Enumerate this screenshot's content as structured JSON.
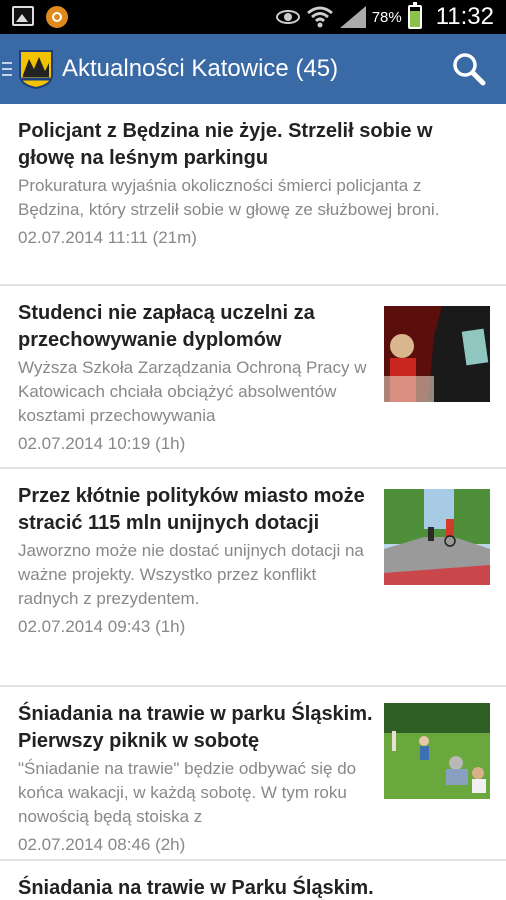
{
  "status_bar": {
    "battery": "78%",
    "time": "11:32",
    "icons": [
      "image-icon",
      "sync-app-icon",
      "eye-icon",
      "wifi-icon",
      "signal-icon",
      "battery-icon"
    ]
  },
  "header": {
    "title": "Aktualności Katowice (45)",
    "accent_color": "#3a6aa6",
    "icons": [
      "menu-icon",
      "city-logo-icon",
      "search-icon"
    ]
  },
  "articles": [
    {
      "title": "Policjant z Będzina nie żyje. Strzelił sobie w głowę na leśnym parkingu",
      "summary": "Prokuratura wyjaśnia okoliczności śmierci policjanta z Będzina, który strzelił sobie w głowę ze służbowej broni.",
      "date": "02.07.2014 11:11 (21m)",
      "thumbnail": null
    },
    {
      "title": "Studenci nie zapłacą uczelni za przechowywanie dyplomów",
      "summary": "Wyższa Szkoła Zarządzania Ochroną Pracy w Katowicach chciała obciążyć absolwentów kosztami przechowywania",
      "date": "02.07.2014 10:19 (1h)",
      "thumbnail": "graduation-photo"
    },
    {
      "title": "Przez kłótnie polityków miasto może stracić 115 mln unijnych dotacji",
      "summary": "Jaworzno może nie dostać unijnych dotacji na ważne projekty. Wszystko przez konflikt radnych z prezydentem.",
      "date": "02.07.2014 09:43 (1h)",
      "thumbnail": "bike-path-photo"
    },
    {
      "title": "Śniadania na trawie w parku Śląskim. Pierwszy piknik w sobotę",
      "summary": "\"Śniadanie na trawie\" będzie odbywać się do końca wakacji, w każdą sobotę. W tym roku nowością będą stoiska z",
      "date": "02.07.2014 08:46 (2h)",
      "thumbnail": "park-picnic-photo"
    },
    {
      "title": "Śniadania na trawie w Parku Śląskim.",
      "summary": "",
      "date": "",
      "thumbnail": null
    }
  ]
}
